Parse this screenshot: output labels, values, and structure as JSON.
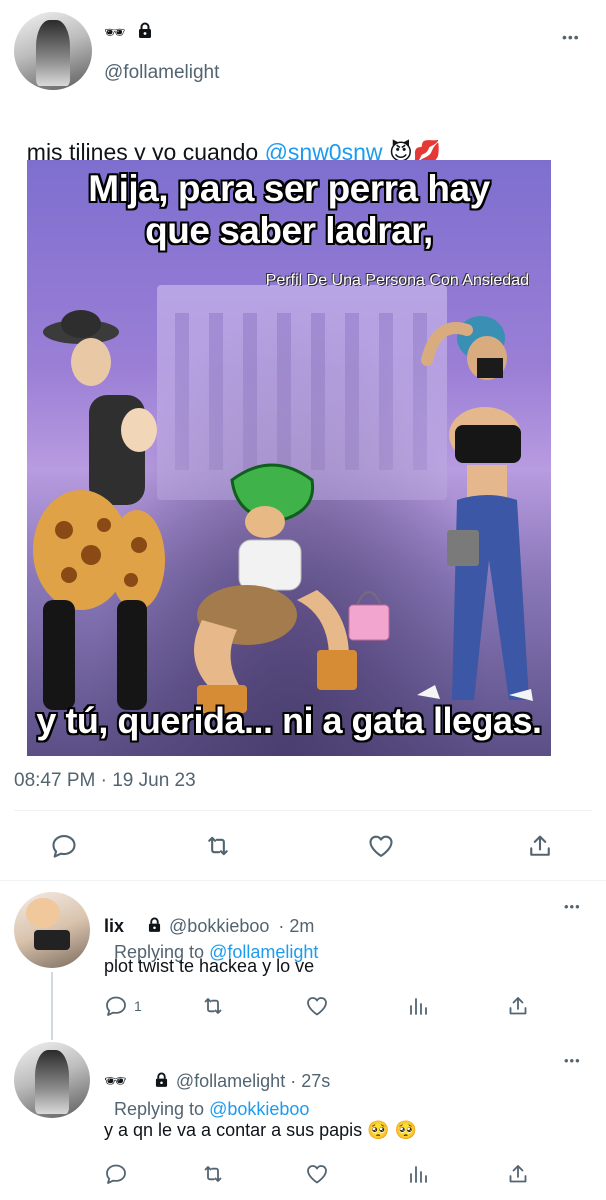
{
  "main_tweet": {
    "display_emoji": "🕶",
    "handle": "@follamelight",
    "text_before_mention": "mis tilines y yo cuando ",
    "mention": "@snw0snw",
    "text_after_mention": " 😈💋",
    "meme": {
      "top_line_1": "Mija, para ser perra hay",
      "top_line_2": "que saber ladrar,",
      "watermark": "Perfil De Una Persona Con Ansiedad",
      "bottom_line": "y tú, querida... ni a gata llegas."
    },
    "timestamp": "08:47 PM · 19 Jun 23"
  },
  "replies": [
    {
      "name": "lix",
      "handle": "@bokkieboo",
      "time": " · 2m",
      "replying_prefix": "Replying to ",
      "replying_to": "@follamelight",
      "text": "plot twist te hackea y lo ve",
      "reply_count": "1"
    },
    {
      "name": "🕶",
      "handle": "@follamelight",
      "time": " · 27s",
      "replying_prefix": "Replying to ",
      "replying_to": "@bokkieboo",
      "text": "y a qn le va a contar a sus papis 🥺 🥺",
      "reply_count": ""
    }
  ],
  "icons": {
    "more": "more-dots-icon",
    "lock": "lock-icon",
    "reply": "reply-icon",
    "retweet": "retweet-icon",
    "like": "heart-icon",
    "views": "views-icon",
    "share": "share-icon"
  },
  "more_label": "•••",
  "colors": {
    "accent": "#1d9bf0",
    "muted": "#536471",
    "text": "#0f1419"
  }
}
